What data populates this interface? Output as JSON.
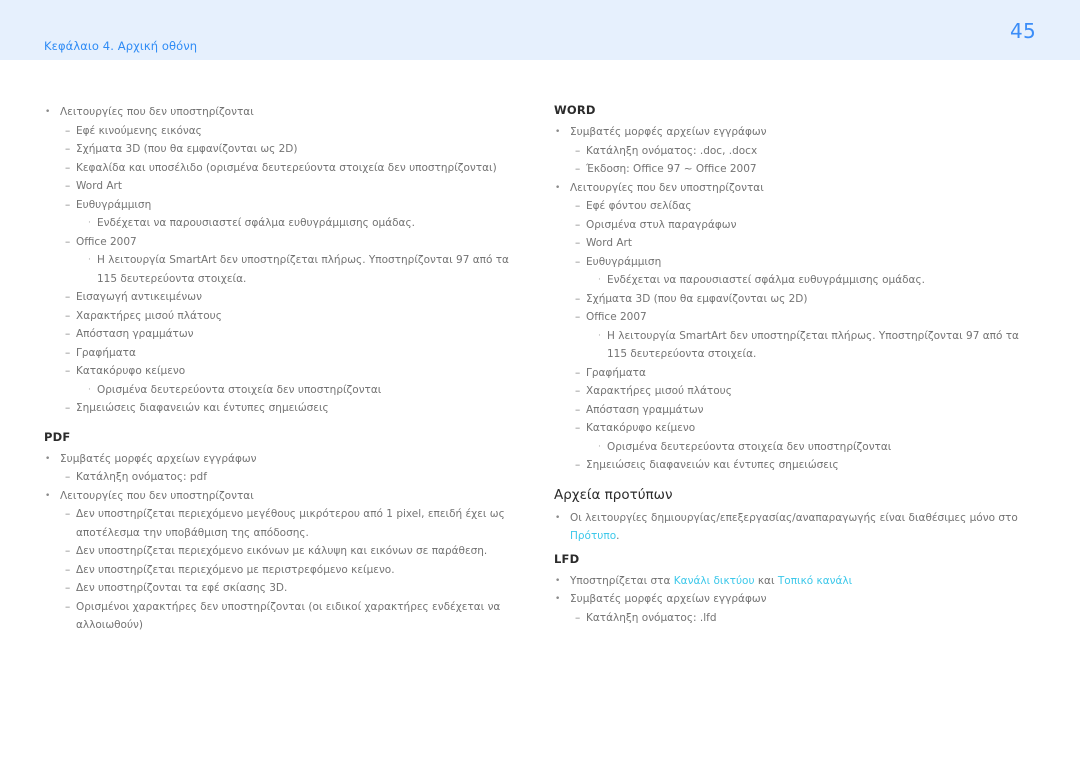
{
  "header": {
    "chapter": "Κεφάλαιο 4. Αρχική οθόνη",
    "page_number": "45",
    "band_color": "#e6f0fd",
    "text_color": "#2e8bf5"
  },
  "theme": {
    "link_color": "#3cc8ea",
    "body_text_color": "#737373",
    "heading_color": "#2b2b2b"
  },
  "left_column": {
    "powerpoint_continued": {
      "items": [
        {
          "level": 1,
          "text": "Λειτουργίες που δεν υποστηρίζονται"
        },
        {
          "level": 2,
          "text": "Εφέ κινούμενης εικόνας"
        },
        {
          "level": 2,
          "text": "Σχήματα 3D (που θα εμφανίζονται ως 2D)"
        },
        {
          "level": 2,
          "text": "Κεφαλίδα και υποσέλιδο (ορισμένα δευτερεύοντα στοιχεία δεν υποστηρίζονται)"
        },
        {
          "level": 2,
          "text": "Word Art"
        },
        {
          "level": 2,
          "text": "Ευθυγράμμιση"
        },
        {
          "level": 3,
          "text": "Ενδέχεται να παρουσιαστεί σφάλμα ευθυγράμμισης ομάδας."
        },
        {
          "level": 2,
          "text": "Office 2007"
        },
        {
          "level": 3,
          "text": "Η λειτουργία SmartArt δεν υποστηρίζεται πλήρως. Υποστηρίζονται 97 από τα 115 δευτερεύοντα στοιχεία."
        },
        {
          "level": 2,
          "text": "Εισαγωγή αντικειμένων"
        },
        {
          "level": 2,
          "text": "Χαρακτήρες μισού πλάτους"
        },
        {
          "level": 2,
          "text": "Απόσταση γραμμάτων"
        },
        {
          "level": 2,
          "text": "Γραφήματα"
        },
        {
          "level": 2,
          "text": "Κατακόρυφο κείμενο"
        },
        {
          "level": 3,
          "text": "Ορισμένα δευτερεύοντα στοιχεία δεν υποστηρίζονται"
        },
        {
          "level": 2,
          "text": "Σημειώσεις διαφανειών και έντυπες σημειώσεις"
        }
      ]
    },
    "pdf": {
      "heading": "PDF",
      "items": [
        {
          "level": 1,
          "text": "Συμβατές μορφές αρχείων εγγράφων"
        },
        {
          "level": 2,
          "text": "Κατάληξη ονόματος: pdf"
        },
        {
          "level": 1,
          "text": "Λειτουργίες που δεν υποστηρίζονται"
        },
        {
          "level": 2,
          "text": "Δεν υποστηρίζεται περιεχόμενο μεγέθους μικρότερου από 1 pixel, επειδή έχει ως αποτέλεσμα την υποβάθμιση της απόδοσης."
        },
        {
          "level": 2,
          "text": "Δεν υποστηρίζεται περιεχόμενο εικόνων με κάλυψη και εικόνων σε παράθεση."
        },
        {
          "level": 2,
          "text": "Δεν υποστηρίζεται περιεχόμενο με περιστρεφόμενο κείμενο."
        },
        {
          "level": 2,
          "text": "Δεν υποστηρίζονται τα εφέ σκίασης 3D."
        },
        {
          "level": 2,
          "text": "Ορισμένοι χαρακτήρες δεν υποστηρίζονται (οι ειδικοί χαρακτήρες ενδέχεται να αλλοιωθούν)"
        }
      ]
    }
  },
  "right_column": {
    "word": {
      "heading": "WORD",
      "items": [
        {
          "level": 1,
          "text": "Συμβατές μορφές αρχείων εγγράφων"
        },
        {
          "level": 2,
          "text": "Κατάληξη ονόματος: .doc, .docx"
        },
        {
          "level": 2,
          "text": "Έκδοση: Office 97 ~ Office 2007"
        },
        {
          "level": 1,
          "text": "Λειτουργίες που δεν υποστηρίζονται"
        },
        {
          "level": 2,
          "text": "Εφέ φόντου σελίδας"
        },
        {
          "level": 2,
          "text": "Ορισμένα στυλ παραγράφων"
        },
        {
          "level": 2,
          "text": "Word Art"
        },
        {
          "level": 2,
          "text": "Ευθυγράμμιση"
        },
        {
          "level": 3,
          "text": "Ενδέχεται να παρουσιαστεί σφάλμα ευθυγράμμισης ομάδας."
        },
        {
          "level": 2,
          "text": "Σχήματα 3D (που θα εμφανίζονται ως 2D)"
        },
        {
          "level": 2,
          "text": "Office 2007"
        },
        {
          "level": 3,
          "text": "Η λειτουργία SmartArt δεν υποστηρίζεται πλήρως. Υποστηρίζονται 97 από τα 115 δευτερεύοντα στοιχεία."
        },
        {
          "level": 2,
          "text": "Γραφήματα"
        },
        {
          "level": 2,
          "text": "Χαρακτήρες μισού πλάτους"
        },
        {
          "level": 2,
          "text": "Απόσταση γραμμάτων"
        },
        {
          "level": 2,
          "text": "Κατακόρυφο κείμενο"
        },
        {
          "level": 3,
          "text": "Ορισμένα δευτερεύοντα στοιχεία δεν υποστηρίζονται"
        },
        {
          "level": 2,
          "text": "Σημειώσεις διαφανειών και έντυπες σημειώσεις"
        }
      ]
    },
    "templates": {
      "heading": "Αρχεία προτύπων",
      "bullet_text_before": "Οι λειτουργίες δημιουργίας/επεξεργασίας/αναπαραγωγής είναι διαθέσιμες μόνο στο ",
      "bullet_link": "Πρότυπο",
      "bullet_text_after": "."
    },
    "lfd": {
      "heading": "LFD",
      "supported_prefix": "Υποστηρίζεται στα ",
      "supported_link_1": "Κανάλι δικτύου",
      "supported_conjunction": " και ",
      "supported_link_2": "Τοπικό κανάλι",
      "items": [
        {
          "level": 1,
          "text": "Συμβατές μορφές αρχείων εγγράφων"
        },
        {
          "level": 2,
          "text": "Κατάληξη ονόματος: .lfd"
        }
      ]
    }
  },
  "markers": {
    "level1": "•",
    "level2": "–",
    "level3": "·"
  }
}
